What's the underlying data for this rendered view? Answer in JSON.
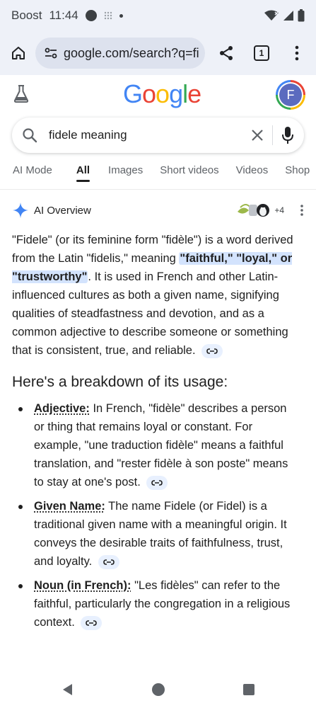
{
  "status_bar": {
    "carrier": "Boost",
    "time": "11:44"
  },
  "browser": {
    "url": "google.com/search?q=fi",
    "tab_count": "1"
  },
  "google": {
    "logo_letters": [
      "G",
      "o",
      "o",
      "g",
      "l",
      "e"
    ],
    "logo_colors": [
      "#4285f4",
      "#ea4335",
      "#fbbc05",
      "#4285f4",
      "#34a853",
      "#ea4335"
    ],
    "avatar_initial": "F"
  },
  "search": {
    "query": "fidele meaning"
  },
  "tabs": [
    "AI Mode",
    "All",
    "Images",
    "Short videos",
    "Videos",
    "Shop"
  ],
  "ai_overview": {
    "title": "AI Overview",
    "source_count": "+4",
    "intro": {
      "before": "\"Fidele\" (or its feminine form \"fidèle\") is a word derived from the Latin \"fidelis,\" meaning ",
      "highlight": "\"faithful,\" \"loyal,\" or \"trustworthy\"",
      "after": ". It is used in French and other Latin-influenced cultures as both a given name, signifying qualities of steadfastness and devotion, and as a common adjective to describe someone or something that is consistent, true, and reliable."
    },
    "breakdown_heading": "Here's a breakdown of its usage:",
    "items": [
      {
        "term": "Adjective:",
        "text": " In French, \"fidèle\" describes a person or thing that remains loyal or constant. For example, \"une traduction fidèle\" means a faithful translation, and \"rester fidèle à son poste\" means to stay at one's post."
      },
      {
        "term": "Given Name:",
        "text": " The name Fidele (or Fidel) is a traditional given name with a meaningful origin. It conveys the desirable traits of faithfulness, trust, and loyalty."
      },
      {
        "term": "Noun (in French):",
        "text": " \"Les fidèles\" can refer to the faithful, particularly the congregation in a religious context."
      }
    ]
  },
  "icons": {
    "home": "home-icon",
    "site_settings": "site-settings-icon",
    "share": "share-icon",
    "tabs": "tabs-icon",
    "menu": "more-vert-icon",
    "labs": "labs-flask-icon",
    "search": "search-icon",
    "clear": "close-icon",
    "mic": "mic-icon",
    "sparkle": "gemini-sparkle-icon",
    "link": "link-icon",
    "back": "back-icon",
    "home_nav": "home-circle-icon",
    "recents": "recents-icon"
  },
  "colors": {
    "accent": "#1a73e8",
    "highlight": "#d3e3fd",
    "chrome_bg": "#eef1f8"
  }
}
